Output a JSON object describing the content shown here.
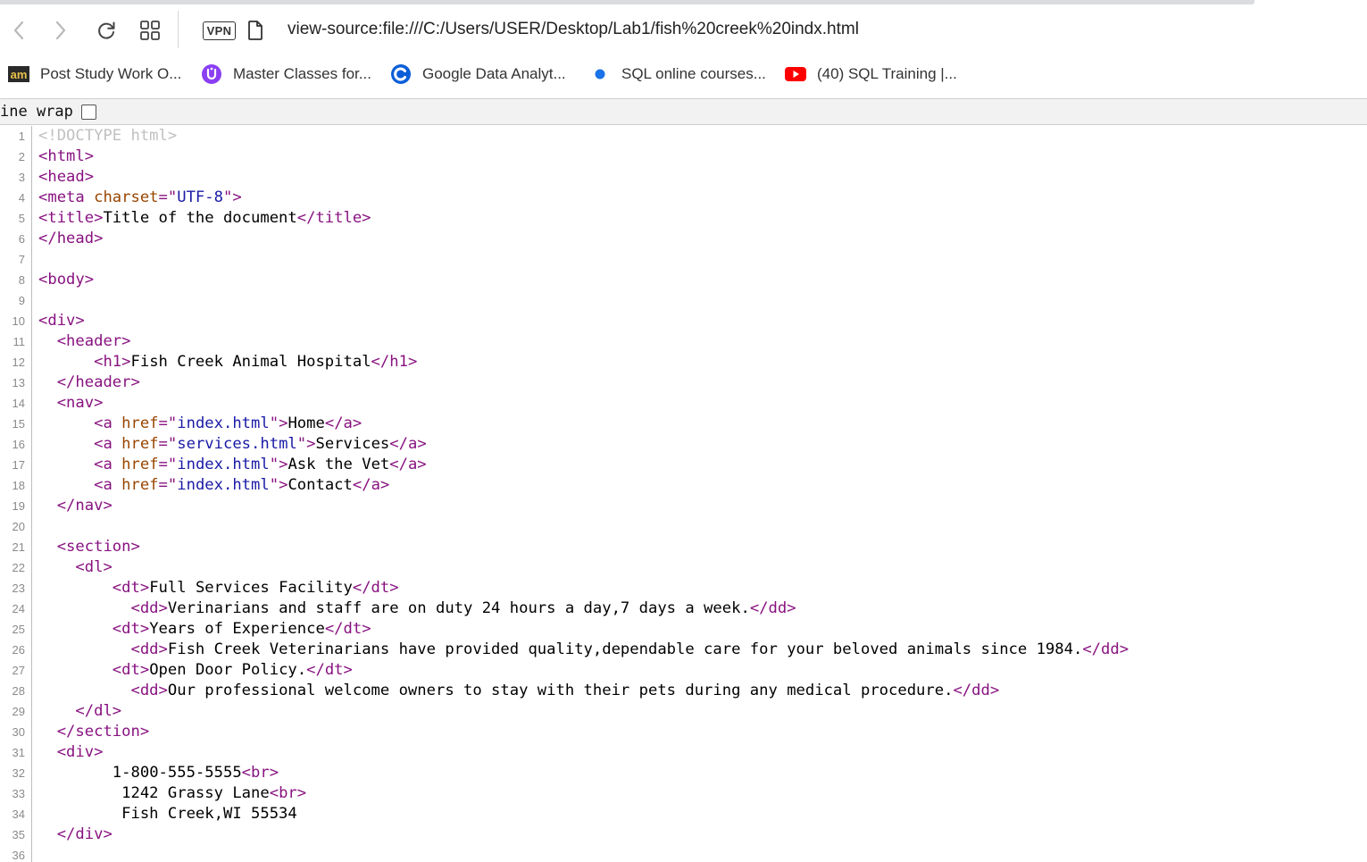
{
  "toolbar": {
    "back_icon": "chevron-left-icon",
    "forward_icon": "chevron-right-icon",
    "reload_icon": "reload-icon",
    "apps_icon": "grid-icon",
    "vpn_label": "VPN",
    "page_icon": "document-icon",
    "url": "view-source:file:///C:/Users/USER/Desktop/Lab1/fish%20creek%20indx.html"
  },
  "bookmarks": [
    {
      "label": "Post Study Work O...",
      "icon": "am-logo-icon"
    },
    {
      "label": "Master Classes for...",
      "icon": "purple-u-icon"
    },
    {
      "label": "Google Data Analyt...",
      "icon": "coursera-c-icon"
    },
    {
      "label": "SQL online courses...",
      "icon": "blue-dot-icon"
    },
    {
      "label": "(40) SQL Training |...",
      "icon": "youtube-icon"
    }
  ],
  "viewer": {
    "line_wrap_label": "ine wrap",
    "line_wrap_checked": false
  },
  "source": {
    "line_numbers": [
      "1",
      "2",
      "3",
      "4",
      "5",
      "6",
      "7",
      "8",
      "9",
      "10",
      "11",
      "12",
      "13",
      "14",
      "15",
      "16",
      "17",
      "18",
      "19",
      "20",
      "21",
      "22",
      "23",
      "24",
      "25",
      "26",
      "27",
      "28",
      "29",
      "30",
      "31",
      "32",
      "33",
      "34",
      "35",
      "36"
    ],
    "l1": {
      "doctype": "<!DOCTYPE html>"
    },
    "l2": {
      "tag": "<html>"
    },
    "l3": {
      "tag": "<head>"
    },
    "l4": {
      "open": "<meta ",
      "attr": "charset",
      "eq": "=\"",
      "val": "UTF-8",
      "close": "\">"
    },
    "l5": {
      "open": "<title>",
      "text": "Title of the document",
      "close": "</title>"
    },
    "l6": {
      "tag": "</head>"
    },
    "l8": {
      "tag": "<body>"
    },
    "l10": {
      "tag": "<div>"
    },
    "l11": {
      "indent": "  ",
      "tag": "<header>"
    },
    "l12": {
      "indent": "      ",
      "open": "<h1>",
      "text": "Fish Creek Animal Hospital",
      "close": "</h1>"
    },
    "l13": {
      "indent": "  ",
      "tag": "</header>"
    },
    "l14": {
      "indent": "  ",
      "tag": "<nav>"
    },
    "l15": {
      "indent": "      ",
      "open": "<a ",
      "attr": "href",
      "eq": "=\"",
      "val": "index.html",
      "gt": "\">",
      "text": "Home",
      "close": "</a>"
    },
    "l16": {
      "indent": "      ",
      "open": "<a ",
      "attr": "href",
      "eq": "=\"",
      "val": "services.html",
      "gt": "\">",
      "text": "Services",
      "close": "</a>"
    },
    "l17": {
      "indent": "      ",
      "open": "<a ",
      "attr": "href",
      "eq": "=\"",
      "val": "index.html",
      "gt": "\">",
      "text": "Ask the Vet",
      "close": "</a>"
    },
    "l18": {
      "indent": "      ",
      "open": "<a ",
      "attr": "href",
      "eq": "=\"",
      "val": "index.html",
      "gt": "\">",
      "text": "Contact",
      "close": "</a>"
    },
    "l19": {
      "indent": "  ",
      "tag": "</nav>"
    },
    "l21": {
      "indent": "  ",
      "tag": "<section>"
    },
    "l22": {
      "indent": "    ",
      "tag": "<dl>"
    },
    "l23": {
      "indent": "        ",
      "open": "<dt>",
      "text": "Full Services Facility",
      "close": "</dt>"
    },
    "l24": {
      "indent": "          ",
      "open": "<dd>",
      "text": "Verinarians and staff are on duty 24 hours a day,7 days a week.",
      "close": "</dd>"
    },
    "l25": {
      "indent": "        ",
      "open": "<dt>",
      "text": "Years of Experience",
      "close": "</dt>"
    },
    "l26": {
      "indent": "          ",
      "open": "<dd>",
      "text": "Fish Creek Veterinarians have provided quality,dependable care for your beloved animals since 1984.",
      "close": "</dd>"
    },
    "l27": {
      "indent": "        ",
      "open": "<dt>",
      "text": "Open Door Policy.",
      "close": "</dt>"
    },
    "l28": {
      "indent": "          ",
      "open": "<dd>",
      "text": "Our professional welcome owners to stay with their pets during any medical procedure.",
      "close": "</dd>"
    },
    "l29": {
      "indent": "    ",
      "tag": "</dl>"
    },
    "l30": {
      "indent": "  ",
      "tag": "</section>"
    },
    "l31": {
      "indent": "  ",
      "tag": "<div>"
    },
    "l32": {
      "indent": "        ",
      "text": "1-800-555-5555",
      "close": "<br>"
    },
    "l33": {
      "indent": "         ",
      "text": "1242 Grassy Lane",
      "close": "<br>"
    },
    "l34": {
      "indent": "         ",
      "text": "Fish Creek,WI 55534"
    },
    "l35": {
      "indent": "  ",
      "tag": "</div>"
    }
  }
}
